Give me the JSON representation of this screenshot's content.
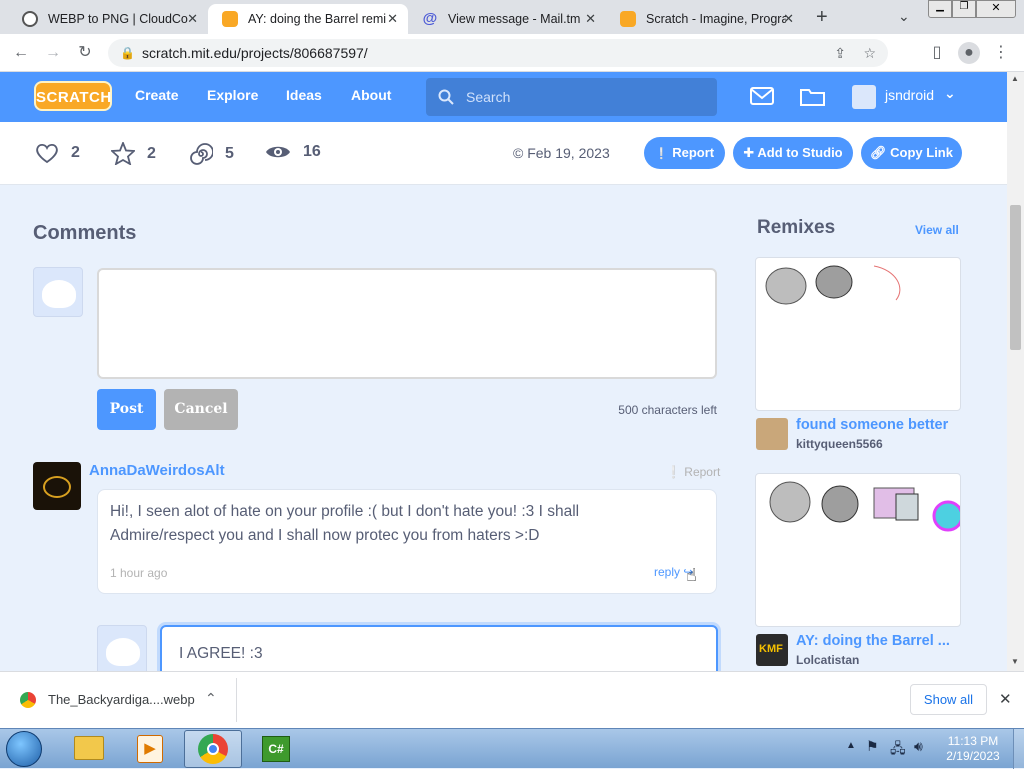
{
  "browser": {
    "tabs": [
      {
        "label": "WEBP to PNG | CloudCon",
        "icon": "cloudconvert-icon",
        "active": false
      },
      {
        "label": "AY: doing the Barrel remi",
        "icon": "scratch-icon",
        "active": true
      },
      {
        "label": "View message - Mail.tm",
        "icon": "at-icon",
        "active": false
      },
      {
        "label": "Scratch - Imagine, Progra",
        "icon": "scratch-icon",
        "active": false
      }
    ],
    "url": "scratch.mit.edu/projects/806687597/",
    "accent": "#4d97ff"
  },
  "nav": {
    "logo": "SCRATCH",
    "links": [
      "Create",
      "Explore",
      "Ideas",
      "About"
    ],
    "search_placeholder": "Search",
    "username": "jsndroid"
  },
  "stats": {
    "loves": "2",
    "favorites": "2",
    "remixes": "5",
    "views": "16",
    "date": "Feb 19, 2023",
    "report_label": "Report",
    "add_studio_label": "Add to Studio",
    "copy_link_label": "Copy Link"
  },
  "comments": {
    "heading": "Comments",
    "post_label": "Post",
    "cancel_label": "Cancel",
    "chars_left": "500 characters left",
    "items": [
      {
        "author": "AnnaDaWeirdosAlt",
        "report_label": "Report",
        "text_line1": "Hi!, I seen alot of hate on your profile :( but I don't hate you! :3 I shall",
        "text_line2": "Admire/respect you and I shall now protec you from haters >:D",
        "time": "1 hour ago",
        "reply_label": "reply"
      }
    ],
    "reply_draft": "I AGREE! :3"
  },
  "remixes": {
    "heading": "Remixes",
    "view_all": "View all",
    "items": [
      {
        "title": "found someone better",
        "user": "kittyqueen5566"
      },
      {
        "title": "AY: doing the Barrel ...",
        "user": "Lolcatistan"
      }
    ]
  },
  "download_bar": {
    "filename": "The_Backyardiga....webp",
    "show_all": "Show all"
  },
  "taskbar": {
    "time": "11:13 PM",
    "date": "2/19/2023"
  }
}
